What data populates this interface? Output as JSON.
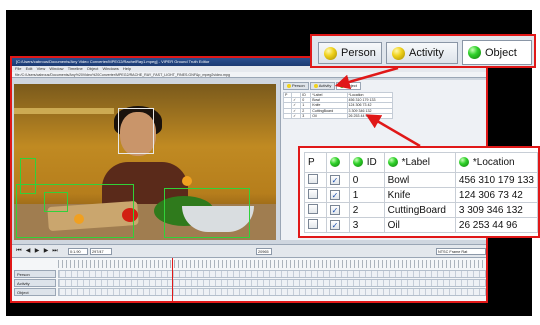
{
  "window": {
    "title": "[C:/Users/cabrous/Documents/Any Video Converter/MPEG2/RachelRay1.mpeg] - VIPER Ground Truth Editor",
    "menu": [
      "File",
      "Edit",
      "View",
      "Window",
      "Timeline",
      "Object",
      "Windows",
      "Help"
    ],
    "path": "file:/C:/Users/cabrous/Documents/Any%20Video%20Converter/MPEG2/RACHE_RAY_FAST_LIGHT_FINES.GNF&p_mpeg2video.mpg"
  },
  "tabs": [
    {
      "label": "Person",
      "color": "#f0d21c",
      "icon": "yellow-ball-icon"
    },
    {
      "label": "Activity",
      "color": "#f0d21c",
      "icon": "yellow-ball-icon"
    },
    {
      "label": "Object",
      "color": "#2fd12a",
      "icon": "green-ball-icon",
      "active": true
    }
  ],
  "mini_tabs": [
    "Person",
    "Activity",
    "Object"
  ],
  "objects": {
    "columns": [
      "P",
      "",
      "ID",
      "*Label",
      "*Location"
    ],
    "rows": [
      {
        "p": "",
        "checked": "✓",
        "id": "0",
        "label": "Bowl",
        "location": "456 310 179 133"
      },
      {
        "p": "",
        "checked": "✓",
        "id": "1",
        "label": "Knife",
        "location": "124 306 73 42"
      },
      {
        "p": "",
        "checked": "✓",
        "id": "2",
        "label": "CuttingBoard",
        "location": "3 309 346 132"
      },
      {
        "p": "",
        "checked": "✓",
        "id": "3",
        "label": "Oil",
        "location": "26 253 44 96"
      }
    ]
  },
  "transport": {
    "frame_field": "0:1.90",
    "total_field": "297/47",
    "mid_field": "20965",
    "right_field": "NTSC Frame Rat"
  },
  "tracks": [
    "Person",
    "Activity",
    "Object"
  ]
}
